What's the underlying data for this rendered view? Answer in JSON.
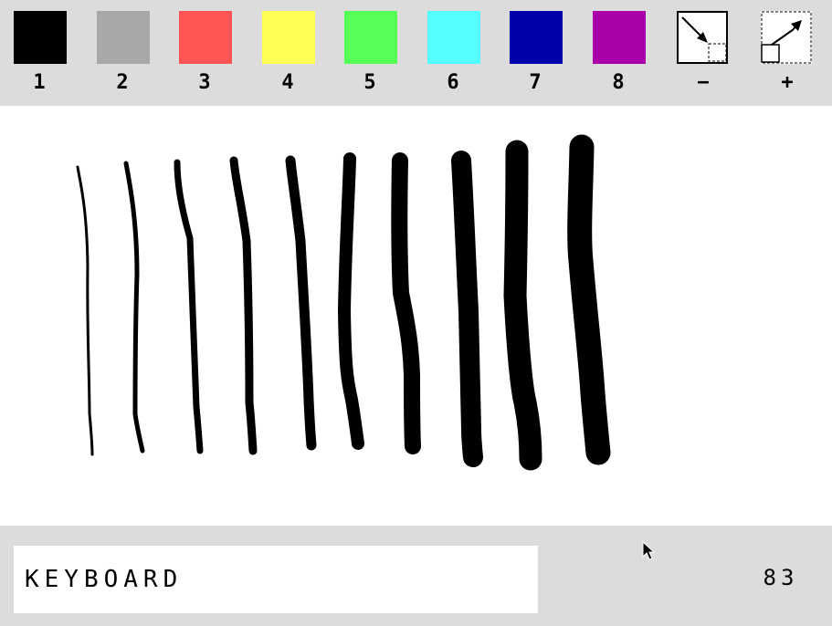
{
  "toolbar": {
    "colors": [
      {
        "label": "1",
        "hex": "#000000",
        "name": "black"
      },
      {
        "label": "2",
        "hex": "#a8a8a8",
        "name": "gray"
      },
      {
        "label": "3",
        "hex": "#ff5555",
        "name": "red"
      },
      {
        "label": "4",
        "hex": "#ffff55",
        "name": "yellow"
      },
      {
        "label": "5",
        "hex": "#55ff55",
        "name": "green"
      },
      {
        "label": "6",
        "hex": "#55ffff",
        "name": "cyan"
      },
      {
        "label": "7",
        "hex": "#0000aa",
        "name": "blue"
      },
      {
        "label": "8",
        "hex": "#aa00aa",
        "name": "magenta"
      }
    ],
    "decrease_label": "−",
    "increase_label": "+",
    "decrease_icon": "shrink-brush-icon",
    "increase_icon": "grow-brush-icon"
  },
  "canvas": {
    "stroke_color": "#000000",
    "strokes": [
      {
        "width": 3
      },
      {
        "width": 5
      },
      {
        "width": 7
      },
      {
        "width": 9
      },
      {
        "width": 11
      },
      {
        "width": 14
      },
      {
        "width": 18
      },
      {
        "width": 22
      },
      {
        "width": 25
      },
      {
        "width": 27
      }
    ]
  },
  "status": {
    "input_mode": "KEYBOARD",
    "count": "83"
  },
  "colors": {
    "chrome": "#dcdcdc",
    "canvas": "#ffffff",
    "text": "#000000"
  }
}
